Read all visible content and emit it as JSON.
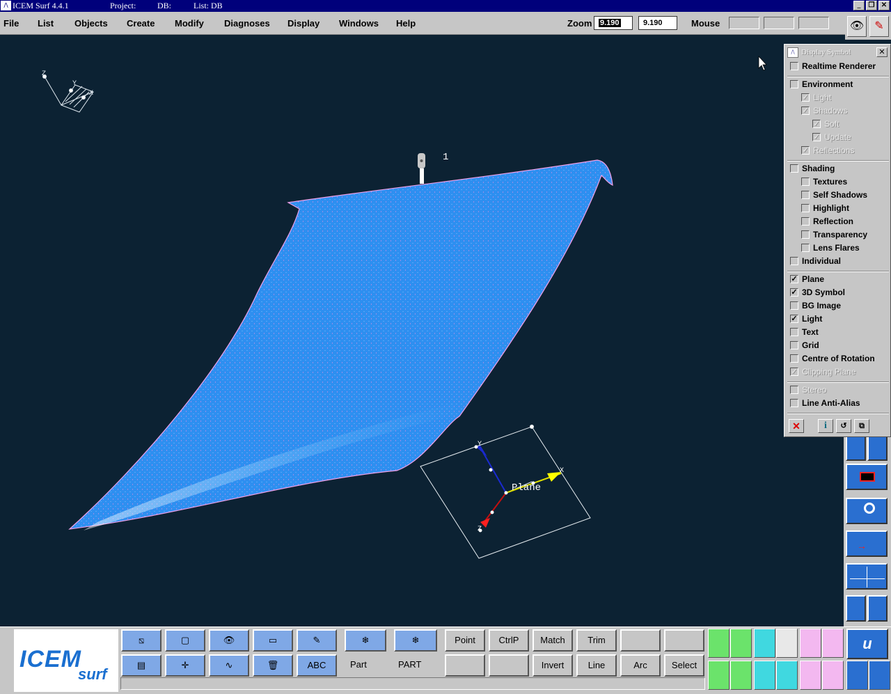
{
  "title_bar": {
    "app": "ICEM Surf 4.4.1",
    "project_label": "Project:",
    "db_label": "DB:",
    "list_label": "List: DB"
  },
  "menu": [
    "File",
    "List",
    "Objects",
    "Create",
    "Modify",
    "Diagnoses",
    "Display",
    "Windows",
    "Help"
  ],
  "zoom": {
    "label": "Zoom",
    "value_1": "9.190",
    "value_2": "9.190"
  },
  "mouse_label": "Mouse",
  "viewport": {
    "point_label": "1",
    "plane_label": "Plane",
    "axis_labels": {
      "x": "X",
      "y": "Y",
      "z": "Z"
    }
  },
  "display_panel": {
    "title": "Display Symbol",
    "items": [
      {
        "label": "Realtime Renderer",
        "checked": false,
        "enabled": true,
        "indent": 0
      },
      {
        "label": "Environment",
        "checked": false,
        "enabled": true,
        "indent": 0
      },
      {
        "label": "Light",
        "checked": true,
        "enabled": false,
        "indent": 1
      },
      {
        "label": "Shadows",
        "checked": true,
        "enabled": false,
        "indent": 1
      },
      {
        "label": "Soft",
        "checked": true,
        "enabled": false,
        "indent": 2
      },
      {
        "label": "Update",
        "checked": true,
        "enabled": false,
        "indent": 2
      },
      {
        "label": "Reflections",
        "checked": true,
        "enabled": false,
        "indent": 1
      },
      {
        "label": "Shading",
        "checked": false,
        "enabled": true,
        "indent": 0
      },
      {
        "label": "Textures",
        "checked": false,
        "enabled": true,
        "indent": 1
      },
      {
        "label": "Self Shadows",
        "checked": false,
        "enabled": true,
        "indent": 1
      },
      {
        "label": "Highlight",
        "checked": false,
        "enabled": true,
        "indent": 1
      },
      {
        "label": "Reflection",
        "checked": false,
        "enabled": true,
        "indent": 1
      },
      {
        "label": "Transparency",
        "checked": false,
        "enabled": true,
        "indent": 1
      },
      {
        "label": "Lens Flares",
        "checked": false,
        "enabled": true,
        "indent": 1
      },
      {
        "label": "Individual",
        "checked": false,
        "enabled": true,
        "indent": 0
      },
      {
        "label": "Plane",
        "checked": true,
        "enabled": true,
        "indent": 0
      },
      {
        "label": "3D Symbol",
        "checked": true,
        "enabled": true,
        "indent": 0
      },
      {
        "label": "BG Image",
        "checked": false,
        "enabled": true,
        "indent": 0
      },
      {
        "label": "Light",
        "checked": true,
        "enabled": true,
        "indent": 0
      },
      {
        "label": "Text",
        "checked": false,
        "enabled": true,
        "indent": 0
      },
      {
        "label": "Grid",
        "checked": false,
        "enabled": true,
        "indent": 0
      },
      {
        "label": "Centre of Rotation",
        "checked": false,
        "enabled": true,
        "indent": 0
      },
      {
        "label": "Clipping Plane",
        "checked": true,
        "enabled": false,
        "indent": 0
      },
      {
        "label": "Stereo",
        "checked": false,
        "enabled": false,
        "indent": 0
      },
      {
        "label": "Line Anti-Alias",
        "checked": false,
        "enabled": true,
        "indent": 0
      }
    ]
  },
  "bottom": {
    "logo_text": "ICEM",
    "logo_sub": "surf",
    "part_label": "Part",
    "part_value": "PART",
    "buttons_row1": [
      "Point",
      "CtrlP",
      "Match",
      "Trim",
      "",
      ""
    ],
    "buttons_row2": [
      "",
      "",
      "Invert",
      "Line",
      "Arc",
      "Select"
    ],
    "side_logo": "u"
  },
  "colors": {
    "viewport_bg": "#0c2233",
    "surface": "#2e8ff0",
    "panel_bg": "#c6c6c6",
    "titlebar": "#00007b"
  }
}
